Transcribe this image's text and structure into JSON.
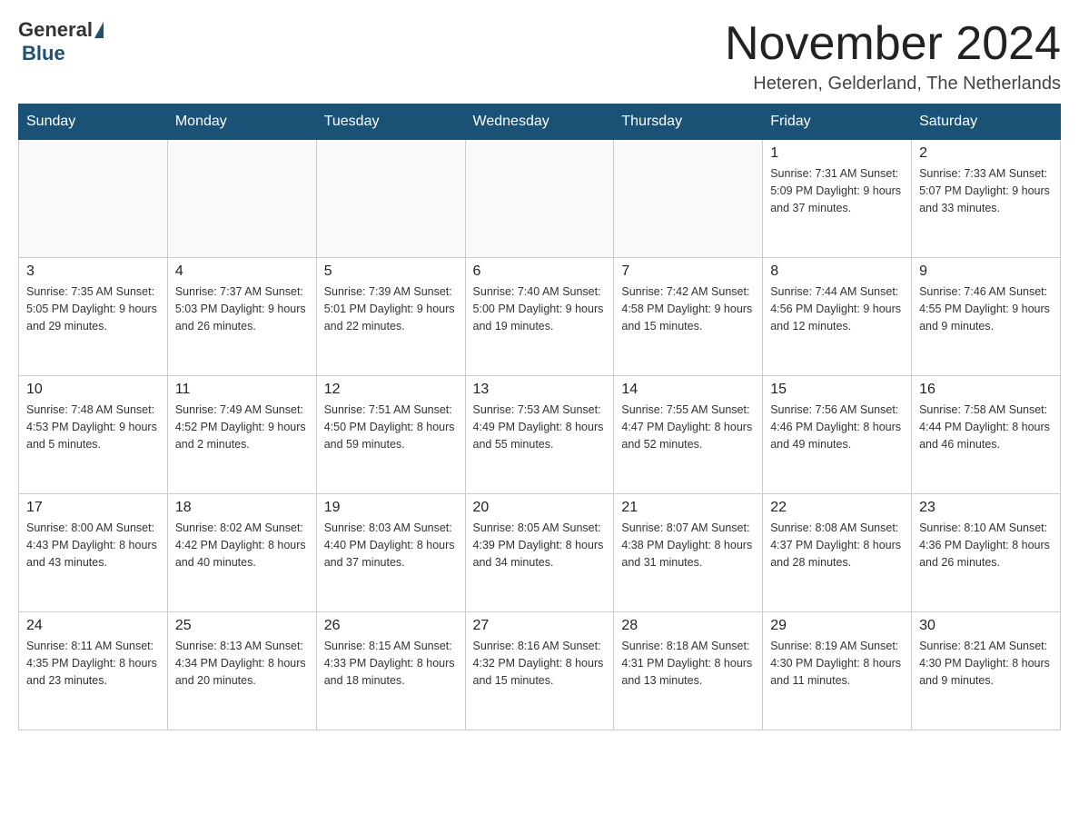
{
  "logo": {
    "general": "General",
    "blue": "Blue"
  },
  "title": "November 2024",
  "location": "Heteren, Gelderland, The Netherlands",
  "weekdays": [
    "Sunday",
    "Monday",
    "Tuesday",
    "Wednesday",
    "Thursday",
    "Friday",
    "Saturday"
  ],
  "weeks": [
    [
      {
        "day": "",
        "info": ""
      },
      {
        "day": "",
        "info": ""
      },
      {
        "day": "",
        "info": ""
      },
      {
        "day": "",
        "info": ""
      },
      {
        "day": "",
        "info": ""
      },
      {
        "day": "1",
        "info": "Sunrise: 7:31 AM\nSunset: 5:09 PM\nDaylight: 9 hours\nand 37 minutes."
      },
      {
        "day": "2",
        "info": "Sunrise: 7:33 AM\nSunset: 5:07 PM\nDaylight: 9 hours\nand 33 minutes."
      }
    ],
    [
      {
        "day": "3",
        "info": "Sunrise: 7:35 AM\nSunset: 5:05 PM\nDaylight: 9 hours\nand 29 minutes."
      },
      {
        "day": "4",
        "info": "Sunrise: 7:37 AM\nSunset: 5:03 PM\nDaylight: 9 hours\nand 26 minutes."
      },
      {
        "day": "5",
        "info": "Sunrise: 7:39 AM\nSunset: 5:01 PM\nDaylight: 9 hours\nand 22 minutes."
      },
      {
        "day": "6",
        "info": "Sunrise: 7:40 AM\nSunset: 5:00 PM\nDaylight: 9 hours\nand 19 minutes."
      },
      {
        "day": "7",
        "info": "Sunrise: 7:42 AM\nSunset: 4:58 PM\nDaylight: 9 hours\nand 15 minutes."
      },
      {
        "day": "8",
        "info": "Sunrise: 7:44 AM\nSunset: 4:56 PM\nDaylight: 9 hours\nand 12 minutes."
      },
      {
        "day": "9",
        "info": "Sunrise: 7:46 AM\nSunset: 4:55 PM\nDaylight: 9 hours\nand 9 minutes."
      }
    ],
    [
      {
        "day": "10",
        "info": "Sunrise: 7:48 AM\nSunset: 4:53 PM\nDaylight: 9 hours\nand 5 minutes."
      },
      {
        "day": "11",
        "info": "Sunrise: 7:49 AM\nSunset: 4:52 PM\nDaylight: 9 hours\nand 2 minutes."
      },
      {
        "day": "12",
        "info": "Sunrise: 7:51 AM\nSunset: 4:50 PM\nDaylight: 8 hours\nand 59 minutes."
      },
      {
        "day": "13",
        "info": "Sunrise: 7:53 AM\nSunset: 4:49 PM\nDaylight: 8 hours\nand 55 minutes."
      },
      {
        "day": "14",
        "info": "Sunrise: 7:55 AM\nSunset: 4:47 PM\nDaylight: 8 hours\nand 52 minutes."
      },
      {
        "day": "15",
        "info": "Sunrise: 7:56 AM\nSunset: 4:46 PM\nDaylight: 8 hours\nand 49 minutes."
      },
      {
        "day": "16",
        "info": "Sunrise: 7:58 AM\nSunset: 4:44 PM\nDaylight: 8 hours\nand 46 minutes."
      }
    ],
    [
      {
        "day": "17",
        "info": "Sunrise: 8:00 AM\nSunset: 4:43 PM\nDaylight: 8 hours\nand 43 minutes."
      },
      {
        "day": "18",
        "info": "Sunrise: 8:02 AM\nSunset: 4:42 PM\nDaylight: 8 hours\nand 40 minutes."
      },
      {
        "day": "19",
        "info": "Sunrise: 8:03 AM\nSunset: 4:40 PM\nDaylight: 8 hours\nand 37 minutes."
      },
      {
        "day": "20",
        "info": "Sunrise: 8:05 AM\nSunset: 4:39 PM\nDaylight: 8 hours\nand 34 minutes."
      },
      {
        "day": "21",
        "info": "Sunrise: 8:07 AM\nSunset: 4:38 PM\nDaylight: 8 hours\nand 31 minutes."
      },
      {
        "day": "22",
        "info": "Sunrise: 8:08 AM\nSunset: 4:37 PM\nDaylight: 8 hours\nand 28 minutes."
      },
      {
        "day": "23",
        "info": "Sunrise: 8:10 AM\nSunset: 4:36 PM\nDaylight: 8 hours\nand 26 minutes."
      }
    ],
    [
      {
        "day": "24",
        "info": "Sunrise: 8:11 AM\nSunset: 4:35 PM\nDaylight: 8 hours\nand 23 minutes."
      },
      {
        "day": "25",
        "info": "Sunrise: 8:13 AM\nSunset: 4:34 PM\nDaylight: 8 hours\nand 20 minutes."
      },
      {
        "day": "26",
        "info": "Sunrise: 8:15 AM\nSunset: 4:33 PM\nDaylight: 8 hours\nand 18 minutes."
      },
      {
        "day": "27",
        "info": "Sunrise: 8:16 AM\nSunset: 4:32 PM\nDaylight: 8 hours\nand 15 minutes."
      },
      {
        "day": "28",
        "info": "Sunrise: 8:18 AM\nSunset: 4:31 PM\nDaylight: 8 hours\nand 13 minutes."
      },
      {
        "day": "29",
        "info": "Sunrise: 8:19 AM\nSunset: 4:30 PM\nDaylight: 8 hours\nand 11 minutes."
      },
      {
        "day": "30",
        "info": "Sunrise: 8:21 AM\nSunset: 4:30 PM\nDaylight: 8 hours\nand 9 minutes."
      }
    ]
  ]
}
